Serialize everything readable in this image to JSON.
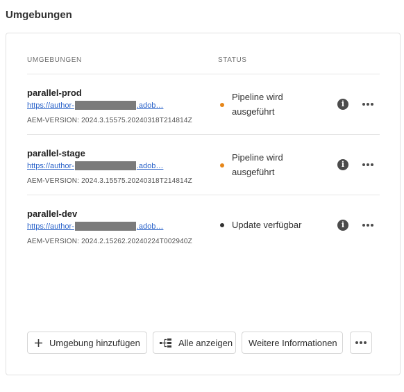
{
  "section_title": "Umgebungen",
  "table": {
    "col_environments": "UMGEBUNGEN",
    "col_status": "STATUS"
  },
  "environments": [
    {
      "name": "parallel-prod",
      "link_prefix": "https://author-",
      "link_suffix": ".adob…",
      "version": "AEM-VERSION: 2024.3.15575.20240318T214814Z",
      "status_line1": "Pipeline wird",
      "status_line2": "ausgeführt",
      "status_color": "#e68619"
    },
    {
      "name": "parallel-stage",
      "link_prefix": "https://author-",
      "link_suffix": ".adob…",
      "version": "AEM-VERSION: 2024.3.15575.20240318T214814Z",
      "status_line1": "Pipeline wird",
      "status_line2": "ausgeführt",
      "status_color": "#e68619"
    },
    {
      "name": "parallel-dev",
      "link_prefix": "https://author-",
      "link_suffix": ".adob…",
      "version": "AEM-VERSION: 2024.2.15262.20240224T002940Z",
      "status_line1": "Update verfügbar",
      "status_line2": "",
      "status_color": "#323232"
    }
  ],
  "buttons": {
    "add_label": "Umgebung hinzufügen",
    "show_all_label": "Alle anzeigen",
    "more_info_label": "Weitere Informationen"
  },
  "icons": {
    "info": "info-icon",
    "more": "more-icon",
    "add": "plus-icon",
    "show_all": "tree-view-icon"
  }
}
